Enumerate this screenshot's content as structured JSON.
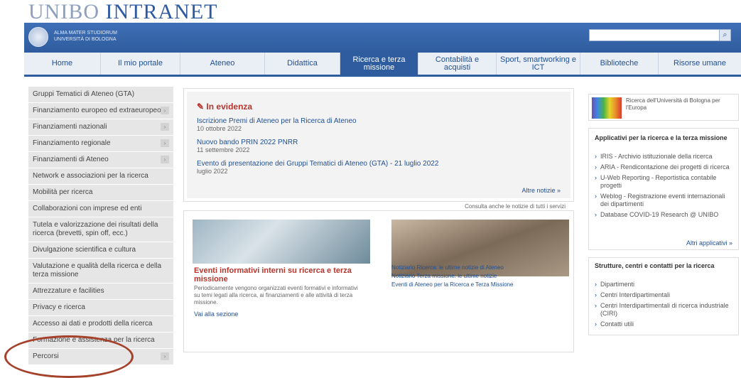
{
  "brand": {
    "part1": "UNIBO",
    "part2": "INTRANET"
  },
  "header": {
    "university_line1": "ALMA MATER STUDIORUM",
    "university_line2": "UNIVERSITÀ DI BOLOGNA",
    "search_placeholder": "",
    "search_icon": "search-icon"
  },
  "nav": [
    "Home",
    "Il mio portale",
    "Ateneo",
    "Didattica",
    "Ricerca e terza missione",
    "Contabilità e acquisti",
    "Sport, smartworking e ICT",
    "Biblioteche",
    "Risorse umane"
  ],
  "sidebar": [
    {
      "label": "Gruppi Tematici di Ateneo (GTA)",
      "arrow": false
    },
    {
      "label": "Finanziamento europeo ed extraeuropeo",
      "arrow": true
    },
    {
      "label": "Finanziamenti nazionali",
      "arrow": true
    },
    {
      "label": "Finanziamento regionale",
      "arrow": true
    },
    {
      "label": "Finanziamenti di Ateneo",
      "arrow": true
    },
    {
      "label": "Network e associazioni per la ricerca",
      "arrow": false
    },
    {
      "label": "Mobilità per ricerca",
      "arrow": false
    },
    {
      "label": "Collaborazioni con imprese ed enti",
      "arrow": false
    },
    {
      "label": "Tutela e valorizzazione dei risultati della ricerca (brevetti, spin off, ecc.)",
      "arrow": false
    },
    {
      "label": "Divulgazione scientifica e cultura",
      "arrow": false
    },
    {
      "label": "Valutazione e qualità della ricerca e della terza missione",
      "arrow": false
    },
    {
      "label": "Attrezzature e facilities",
      "arrow": false
    },
    {
      "label": "Privacy e ricerca",
      "arrow": false
    },
    {
      "label": "Accesso ai dati e prodotti della ricerca",
      "arrow": false
    },
    {
      "label": "Formazione e assistenza per la ricerca",
      "arrow": false
    },
    {
      "label": "Percorsi",
      "arrow": true
    }
  ],
  "evidenza": {
    "title": "In evidenza",
    "news": [
      {
        "title": "Iscrizione Premi di Ateneo per la Ricerca di Ateneo",
        "date": "10 ottobre 2022"
      },
      {
        "title": "Nuovo bando PRIN 2022 PNRR",
        "date": "11 settembre 2022"
      },
      {
        "title": "Evento di presentazione dei Gruppi Tematici di Ateneo (GTA) - 21 luglio 2022",
        "date": "luglio 2022"
      }
    ],
    "more": "Altre notizie »",
    "note": "Consulta anche le notizie di tutti i servizi"
  },
  "events": {
    "title": "Eventi informativi interni su ricerca e terza missione",
    "desc": "Periodicamente vengono organizzati eventi formativi e informativi su temi legati alla ricerca, ai finanziamenti e alle attività di terza missione.",
    "more": "Vai alla sezione",
    "links": [
      "Notiziario Ricerca: le ultime notizie di Ateneo",
      "Notiziario Terza missione: le ultime notizie",
      "Eventi di Ateneo per la Ricerca e Terza Missione"
    ]
  },
  "right": {
    "promo_text": "Ricerca dell'Università di Bologna per l'Europa",
    "apps_title": "Applicativi per la ricerca e la terza missione",
    "apps": [
      "IRIS - Archivio istituzionale della ricerca",
      "ARIA - Rendicontazione dei progetti di ricerca",
      "U-Web Reporting - Reportistica contabile progetti",
      "Weblog - Registrazione eventi internazionali dei dipartimenti",
      "Database COVID-19 Research @ UNIBO"
    ],
    "apps_more": "Altri applicativi »",
    "struct_title": "Strutture, centri e contatti per la ricerca",
    "struct": [
      "Dipartimenti",
      "Centri Interdipartimentali",
      "Centri Interdipartimentali di ricerca industriale (CIRI)",
      "Contatti utili"
    ]
  }
}
